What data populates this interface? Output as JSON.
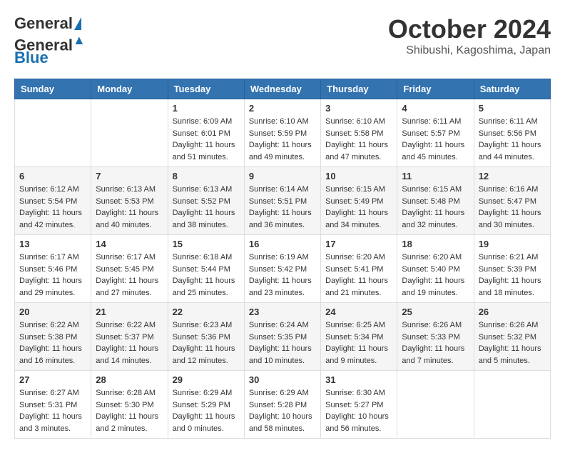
{
  "header": {
    "logo_general": "General",
    "logo_blue": "Blue",
    "month": "October 2024",
    "location": "Shibushi, Kagoshima, Japan"
  },
  "weekdays": [
    "Sunday",
    "Monday",
    "Tuesday",
    "Wednesday",
    "Thursday",
    "Friday",
    "Saturday"
  ],
  "weeks": [
    [
      null,
      null,
      {
        "day": "1",
        "sunrise": "Sunrise: 6:09 AM",
        "sunset": "Sunset: 6:01 PM",
        "daylight": "Daylight: 11 hours and 51 minutes."
      },
      {
        "day": "2",
        "sunrise": "Sunrise: 6:10 AM",
        "sunset": "Sunset: 5:59 PM",
        "daylight": "Daylight: 11 hours and 49 minutes."
      },
      {
        "day": "3",
        "sunrise": "Sunrise: 6:10 AM",
        "sunset": "Sunset: 5:58 PM",
        "daylight": "Daylight: 11 hours and 47 minutes."
      },
      {
        "day": "4",
        "sunrise": "Sunrise: 6:11 AM",
        "sunset": "Sunset: 5:57 PM",
        "daylight": "Daylight: 11 hours and 45 minutes."
      },
      {
        "day": "5",
        "sunrise": "Sunrise: 6:11 AM",
        "sunset": "Sunset: 5:56 PM",
        "daylight": "Daylight: 11 hours and 44 minutes."
      }
    ],
    [
      {
        "day": "6",
        "sunrise": "Sunrise: 6:12 AM",
        "sunset": "Sunset: 5:54 PM",
        "daylight": "Daylight: 11 hours and 42 minutes."
      },
      {
        "day": "7",
        "sunrise": "Sunrise: 6:13 AM",
        "sunset": "Sunset: 5:53 PM",
        "daylight": "Daylight: 11 hours and 40 minutes."
      },
      {
        "day": "8",
        "sunrise": "Sunrise: 6:13 AM",
        "sunset": "Sunset: 5:52 PM",
        "daylight": "Daylight: 11 hours and 38 minutes."
      },
      {
        "day": "9",
        "sunrise": "Sunrise: 6:14 AM",
        "sunset": "Sunset: 5:51 PM",
        "daylight": "Daylight: 11 hours and 36 minutes."
      },
      {
        "day": "10",
        "sunrise": "Sunrise: 6:15 AM",
        "sunset": "Sunset: 5:49 PM",
        "daylight": "Daylight: 11 hours and 34 minutes."
      },
      {
        "day": "11",
        "sunrise": "Sunrise: 6:15 AM",
        "sunset": "Sunset: 5:48 PM",
        "daylight": "Daylight: 11 hours and 32 minutes."
      },
      {
        "day": "12",
        "sunrise": "Sunrise: 6:16 AM",
        "sunset": "Sunset: 5:47 PM",
        "daylight": "Daylight: 11 hours and 30 minutes."
      }
    ],
    [
      {
        "day": "13",
        "sunrise": "Sunrise: 6:17 AM",
        "sunset": "Sunset: 5:46 PM",
        "daylight": "Daylight: 11 hours and 29 minutes."
      },
      {
        "day": "14",
        "sunrise": "Sunrise: 6:17 AM",
        "sunset": "Sunset: 5:45 PM",
        "daylight": "Daylight: 11 hours and 27 minutes."
      },
      {
        "day": "15",
        "sunrise": "Sunrise: 6:18 AM",
        "sunset": "Sunset: 5:44 PM",
        "daylight": "Daylight: 11 hours and 25 minutes."
      },
      {
        "day": "16",
        "sunrise": "Sunrise: 6:19 AM",
        "sunset": "Sunset: 5:42 PM",
        "daylight": "Daylight: 11 hours and 23 minutes."
      },
      {
        "day": "17",
        "sunrise": "Sunrise: 6:20 AM",
        "sunset": "Sunset: 5:41 PM",
        "daylight": "Daylight: 11 hours and 21 minutes."
      },
      {
        "day": "18",
        "sunrise": "Sunrise: 6:20 AM",
        "sunset": "Sunset: 5:40 PM",
        "daylight": "Daylight: 11 hours and 19 minutes."
      },
      {
        "day": "19",
        "sunrise": "Sunrise: 6:21 AM",
        "sunset": "Sunset: 5:39 PM",
        "daylight": "Daylight: 11 hours and 18 minutes."
      }
    ],
    [
      {
        "day": "20",
        "sunrise": "Sunrise: 6:22 AM",
        "sunset": "Sunset: 5:38 PM",
        "daylight": "Daylight: 11 hours and 16 minutes."
      },
      {
        "day": "21",
        "sunrise": "Sunrise: 6:22 AM",
        "sunset": "Sunset: 5:37 PM",
        "daylight": "Daylight: 11 hours and 14 minutes."
      },
      {
        "day": "22",
        "sunrise": "Sunrise: 6:23 AM",
        "sunset": "Sunset: 5:36 PM",
        "daylight": "Daylight: 11 hours and 12 minutes."
      },
      {
        "day": "23",
        "sunrise": "Sunrise: 6:24 AM",
        "sunset": "Sunset: 5:35 PM",
        "daylight": "Daylight: 11 hours and 10 minutes."
      },
      {
        "day": "24",
        "sunrise": "Sunrise: 6:25 AM",
        "sunset": "Sunset: 5:34 PM",
        "daylight": "Daylight: 11 hours and 9 minutes."
      },
      {
        "day": "25",
        "sunrise": "Sunrise: 6:26 AM",
        "sunset": "Sunset: 5:33 PM",
        "daylight": "Daylight: 11 hours and 7 minutes."
      },
      {
        "day": "26",
        "sunrise": "Sunrise: 6:26 AM",
        "sunset": "Sunset: 5:32 PM",
        "daylight": "Daylight: 11 hours and 5 minutes."
      }
    ],
    [
      {
        "day": "27",
        "sunrise": "Sunrise: 6:27 AM",
        "sunset": "Sunset: 5:31 PM",
        "daylight": "Daylight: 11 hours and 3 minutes."
      },
      {
        "day": "28",
        "sunrise": "Sunrise: 6:28 AM",
        "sunset": "Sunset: 5:30 PM",
        "daylight": "Daylight: 11 hours and 2 minutes."
      },
      {
        "day": "29",
        "sunrise": "Sunrise: 6:29 AM",
        "sunset": "Sunset: 5:29 PM",
        "daylight": "Daylight: 11 hours and 0 minutes."
      },
      {
        "day": "30",
        "sunrise": "Sunrise: 6:29 AM",
        "sunset": "Sunset: 5:28 PM",
        "daylight": "Daylight: 10 hours and 58 minutes."
      },
      {
        "day": "31",
        "sunrise": "Sunrise: 6:30 AM",
        "sunset": "Sunset: 5:27 PM",
        "daylight": "Daylight: 10 hours and 56 minutes."
      },
      null,
      null
    ]
  ]
}
